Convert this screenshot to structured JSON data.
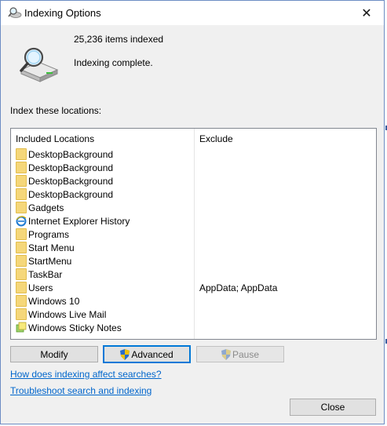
{
  "window": {
    "title": "Indexing Options",
    "close_glyph": "✕"
  },
  "status": {
    "items_indexed": "25,236 items indexed",
    "state": "Indexing complete."
  },
  "locations": {
    "label": "Index these locations:",
    "headers": {
      "included": "Included Locations",
      "exclude": "Exclude"
    },
    "rows": [
      {
        "name": "DesktopBackground",
        "exclude": "",
        "icon": "folder-icon"
      },
      {
        "name": "DesktopBackground",
        "exclude": "",
        "icon": "folder-icon"
      },
      {
        "name": "DesktopBackground",
        "exclude": "",
        "icon": "folder-icon"
      },
      {
        "name": "DesktopBackground",
        "exclude": "",
        "icon": "folder-icon"
      },
      {
        "name": "Gadgets",
        "exclude": "",
        "icon": "folder-icon"
      },
      {
        "name": "Internet Explorer History",
        "exclude": "",
        "icon": "ie-icon"
      },
      {
        "name": "Programs",
        "exclude": "",
        "icon": "folder-icon"
      },
      {
        "name": "Start Menu",
        "exclude": "",
        "icon": "folder-icon"
      },
      {
        "name": "StartMenu",
        "exclude": "",
        "icon": "folder-icon"
      },
      {
        "name": "TaskBar",
        "exclude": "",
        "icon": "folder-icon"
      },
      {
        "name": "Users",
        "exclude": "AppData; AppData",
        "icon": "folder-icon"
      },
      {
        "name": "Windows 10",
        "exclude": "",
        "icon": "folder-icon"
      },
      {
        "name": "Windows Live Mail",
        "exclude": "",
        "icon": "folder-icon"
      },
      {
        "name": "Windows Sticky Notes",
        "exclude": "",
        "icon": "sticky-notes-icon"
      }
    ]
  },
  "buttons": {
    "modify": "Modify",
    "advanced": "Advanced",
    "pause": "Pause",
    "close": "Close"
  },
  "links": {
    "how_indexing": "How does indexing affect searches?",
    "troubleshoot": "Troubleshoot search and indexing"
  },
  "colors": {
    "accent": "#0078d7",
    "link": "#0066cc",
    "folder": "#f5d77a"
  }
}
